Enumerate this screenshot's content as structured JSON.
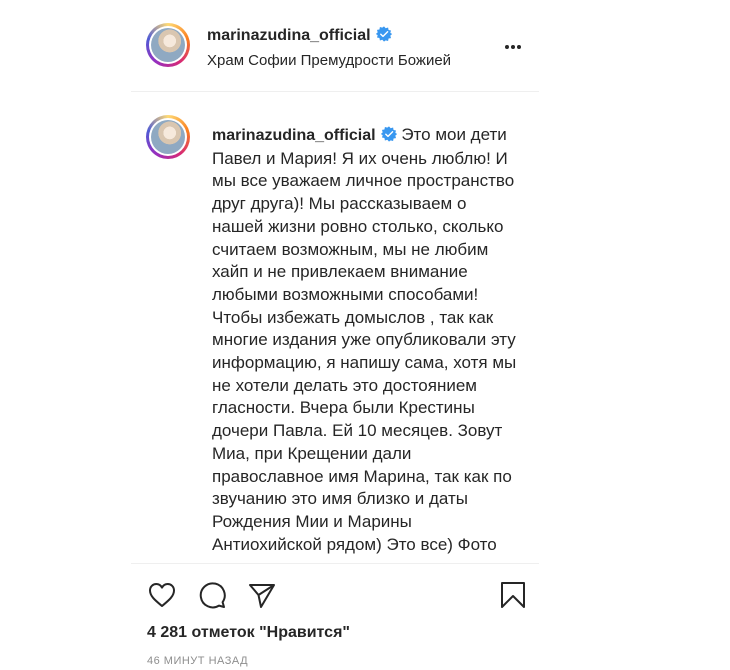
{
  "post": {
    "username": "marinazudina_official",
    "location": "Храм Софии Премудрости Божией"
  },
  "comment": {
    "username": "marinazudina_official",
    "text": "Это мои дети Павел и Мария! Я их очень люблю! И мы все уважаем личное пространство друг друга)! Мы рассказываем о нашей жизни ровно столько, сколько считаем возможным, мы не любим хайп и не привлекаем внимание любыми возможными способами! Чтобы избежать домыслов , так как многие издания уже опубликовали эту информацию, я напишу сама, хотя мы не хотели делать это достоянием гласности. Вчера были Крестины дочери Павла. Ей 10 месяцев. Зовут Миа, при Крещении дали православное имя Марина, так как по звучанию это имя близко и даты Рождения Мии и Марины Антиохийской рядом) Это все) Фото"
  },
  "likes_text": "4 281 отметок \"Нравится\"",
  "timestamp": "46 МИНУТ НАЗАД",
  "icons": {
    "verified": "verified-badge-icon",
    "more": "more-options-icon",
    "like": "heart-icon",
    "comment": "comment-bubble-icon",
    "share": "paper-plane-icon",
    "save": "bookmark-icon"
  },
  "colors": {
    "verified": "#3897f0",
    "text": "#262626",
    "secondary": "#8e8e8e",
    "divider": "#efefef"
  }
}
